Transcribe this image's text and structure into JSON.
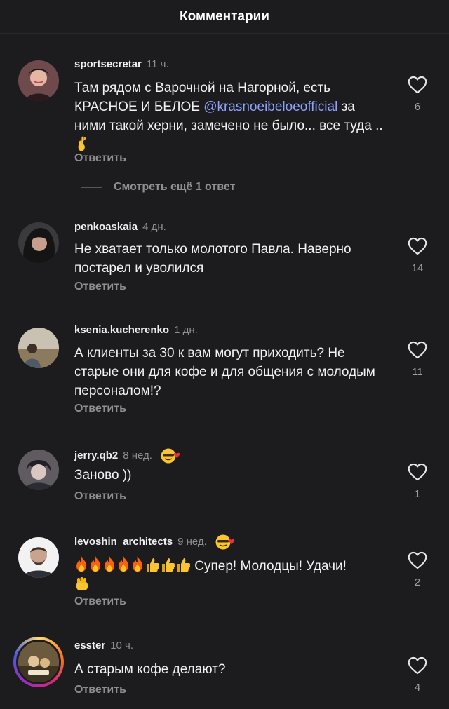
{
  "header": {
    "title": "Комментарии"
  },
  "more_replies": "Смотреть ещё 1 ответ",
  "reply_label": "Ответить",
  "colors": {
    "background": "#1c1c1e",
    "mention": "#8ea2ff",
    "secondary": "#8e8e93"
  },
  "comments": [
    {
      "username": "sportsecretar",
      "time": "11 ч.",
      "text_before": "Там рядом с Варочной на Нагорной, есть КРАСНОЕ И БЕЛОЕ ",
      "mention": "@krasnoeibeloeofficial",
      "text_after": " за ними такой херни, замечено не было... все туда ..",
      "likes": "6"
    },
    {
      "username": "penkoaskaia",
      "time": "4 дн.",
      "text": "Не хватает только молотого Павла. Наверно постарел и уволился",
      "likes": "14"
    },
    {
      "username": "ksenia.kucherenko",
      "time": "1 дн.",
      "text": "А клиенты за 30 к вам могут приходить? Не старые они для кофе и для общения с молодым персоналом!?",
      "likes": "11"
    },
    {
      "username": "jerry.qb2",
      "time": "8 нед.",
      "text": "Заново ))",
      "likes": "1"
    },
    {
      "username": "levoshin_architects",
      "time": "9 нед.",
      "text": "Супер! Молодцы! Удачи!",
      "likes": "2"
    },
    {
      "username": "esster",
      "time": "10 ч.",
      "text": "А старым кофе делают?",
      "likes": "4"
    }
  ]
}
